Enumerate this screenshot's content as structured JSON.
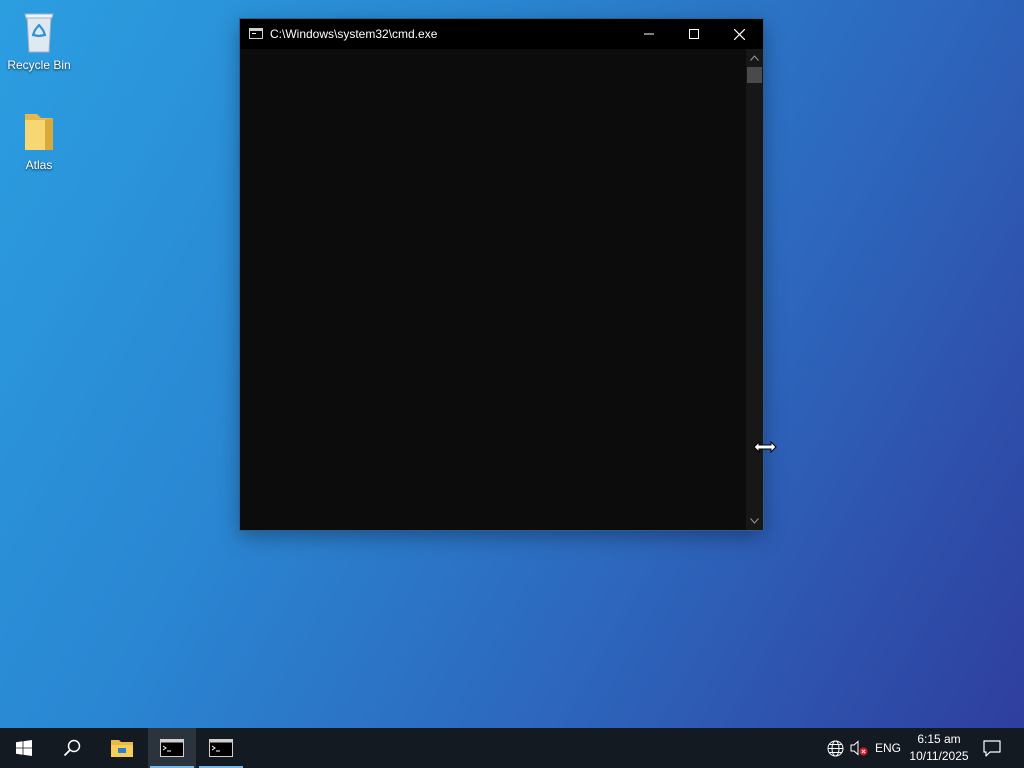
{
  "desktop": {
    "icons": [
      {
        "label": "Recycle Bin",
        "icon": "recycle-bin-icon"
      },
      {
        "label": "Atlas",
        "icon": "folder-icon"
      }
    ]
  },
  "cmd_window": {
    "title": "C:\\Windows\\system32\\cmd.exe",
    "icon": "console-icon",
    "content": "",
    "buttons": {
      "minimize": "minimize-icon",
      "maximize": "maximize-icon",
      "close": "close-icon"
    }
  },
  "taskbar": {
    "items": [
      {
        "name": "start",
        "icon": "windows-logo-icon"
      },
      {
        "name": "search",
        "icon": "search-icon"
      },
      {
        "name": "file-explorer",
        "icon": "folder-icon"
      },
      {
        "name": "cmd-1",
        "icon": "console-icon",
        "active": true
      },
      {
        "name": "cmd-2",
        "icon": "console-icon",
        "active": false
      }
    ],
    "tray": {
      "language": "ENG",
      "network_icon": "network-globe-icon",
      "volume_icon": "volume-muted-icon",
      "time": "6:15 am",
      "date": "10/11/2025",
      "notifications_icon": "action-center-icon"
    }
  },
  "colors": {
    "accent": "#76b9ed",
    "taskbar": "#141a22",
    "console_bg": "#0c0c0c"
  }
}
